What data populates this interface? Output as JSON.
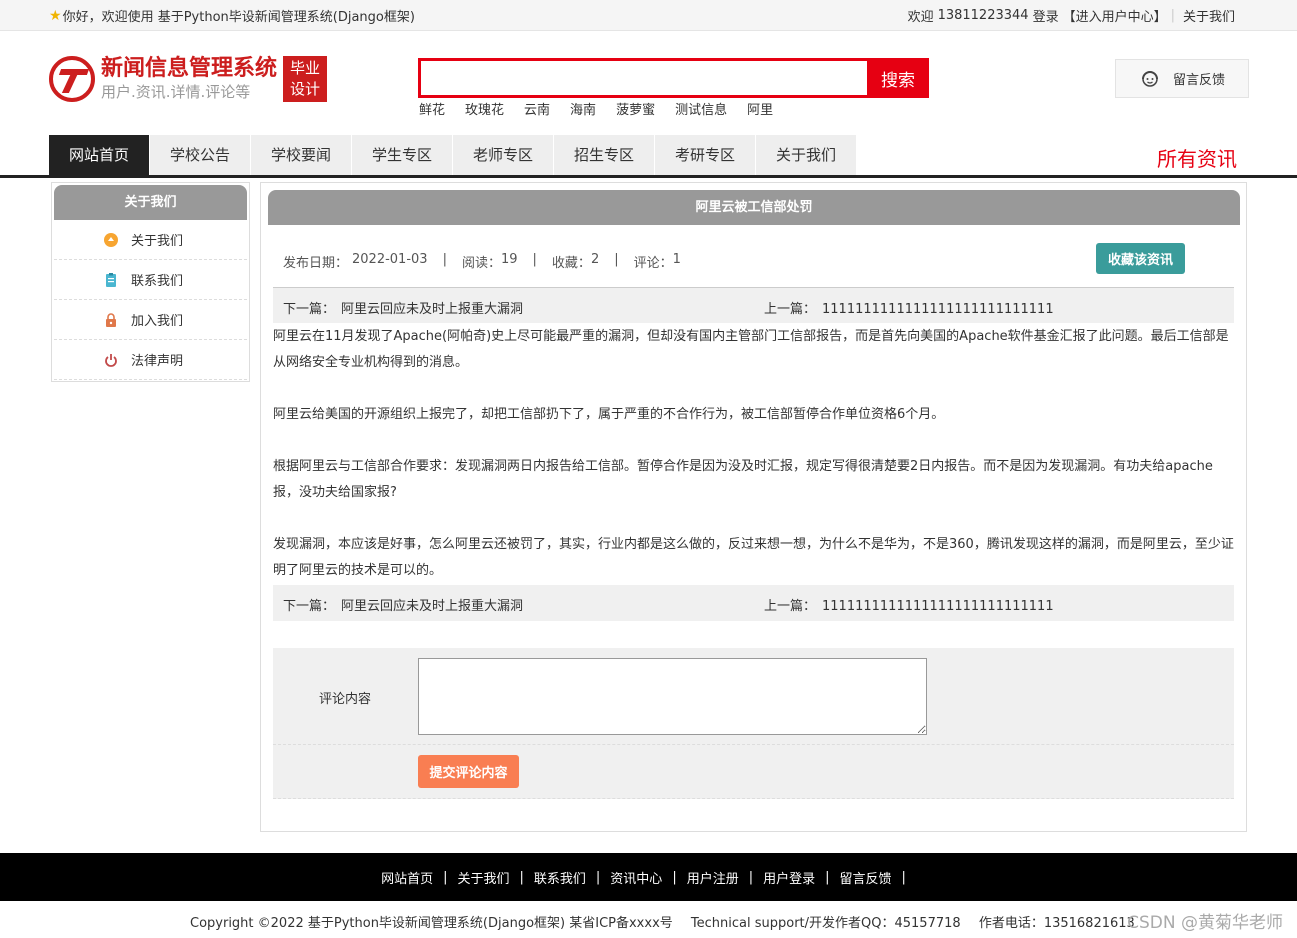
{
  "topbar": {
    "welcome": "你好，欢迎使用 基于Python毕设新闻管理系统(Django框架)",
    "greeting": "欢迎",
    "phone": "13811223344",
    "login": "登录",
    "user_center": "【进入用户中心】",
    "about": "关于我们"
  },
  "header": {
    "logo_title": "新闻信息管理系统",
    "logo_sub": "用户.资讯.详情.评论等",
    "badge_line1": "毕业",
    "badge_line2": "设计",
    "search_button": "搜索",
    "search_value": "",
    "hot_words": [
      "鲜花",
      "玫瑰花",
      "云南",
      "海南",
      "菠萝蜜",
      "测试信息",
      "阿里"
    ],
    "feedback": "留言反馈"
  },
  "nav": {
    "items": [
      "网站首页",
      "学校公告",
      "学校要闻",
      "学生专区",
      "老师专区",
      "招生专区",
      "考研专区",
      "关于我们"
    ],
    "active_index": 0,
    "all_news": "所有资讯"
  },
  "sidebar": {
    "title": "关于我们",
    "items": [
      {
        "label": "关于我们",
        "icon": "circle-icon",
        "color": "#f7a531"
      },
      {
        "label": "联系我们",
        "icon": "clipboard-icon",
        "color": "#4ab6d0"
      },
      {
        "label": "加入我们",
        "icon": "lock-icon",
        "color": "#e0784a"
      },
      {
        "label": "法律声明",
        "icon": "power-icon",
        "color": "#c24a4a"
      }
    ]
  },
  "article": {
    "title": "阿里云被工信部处罚",
    "date_label": "发布日期：",
    "date": "2022-01-03",
    "reads_label": "阅读：",
    "reads": "19",
    "favs_label": "收藏：",
    "favs": "2",
    "comments_label": "评论：",
    "comments": "1",
    "fav_button": "收藏该资讯",
    "next_label": "下一篇：",
    "next_title": "阿里云回应未及时上报重大漏洞",
    "prev_label": "上一篇：",
    "prev_title": "1111111111111111111111111111",
    "paragraphs": [
      "阿里云在11月发现了Apache(阿帕奇)史上尽可能最严重的漏洞，但却没有国内主管部门工信部报告，而是首先向美国的Apache软件基金汇报了此问题。最后工信部是从网络安全专业机构得到的消息。",
      "阿里云给美国的开源组织上报完了，却把工信部扔下了，属于严重的不合作行为，被工信部暂停合作单位资格6个月。",
      "根据阿里云与工信部合作要求：发现漏洞两日内报告给工信部。暂停合作是因为没及时汇报，规定写得很清楚要2日内报告。而不是因为发现漏洞。有功夫给apache报，没功夫给国家报?",
      "发现漏洞，本应该是好事，怎么阿里云还被罚了，其实，行业内都是这么做的，反过来想一想，为什么不是华为，不是360，腾讯发现这样的漏洞，而是阿里云，至少证明了阿里云的技术是可以的。"
    ]
  },
  "comment": {
    "label": "评论内容",
    "value": "",
    "submit": "提交评论内容"
  },
  "footer": {
    "links": [
      "网站首页",
      "关于我们",
      "联系我们",
      "资讯中心",
      "用户注册",
      "用户登录",
      "留言反馈"
    ],
    "copyright": "Copyright ©2022 基于Python毕设新闻管理系统(Django框架) 某省ICP备xxxx号",
    "support": "Technical support/开发作者QQ：45157718",
    "phone": "作者电话：13516821613",
    "watermark": "CSDN @黄菊华老师"
  }
}
